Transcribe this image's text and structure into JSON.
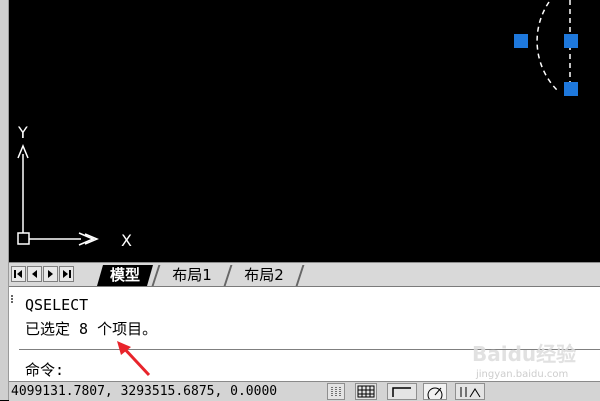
{
  "drawing": {
    "axis_y_label": "Y",
    "axis_x_label": "X"
  },
  "tabs": {
    "model": "模型",
    "layout1": "布局1",
    "layout2": "布局2"
  },
  "command_window": {
    "line1": "QSELECT",
    "line2": "已选定 8 个项目。",
    "prompt": "命令:"
  },
  "status_bar": {
    "coordinates": "4099131.7807, 3293515.6875, 0.0000"
  },
  "colors": {
    "canvas": "#000000",
    "grip": "#1e78dc",
    "annotation_arrow": "#e8242b",
    "active_tab": "#000000"
  },
  "watermark": {
    "logo": "Baidu经验",
    "url": "jingyan.baidu.com"
  }
}
